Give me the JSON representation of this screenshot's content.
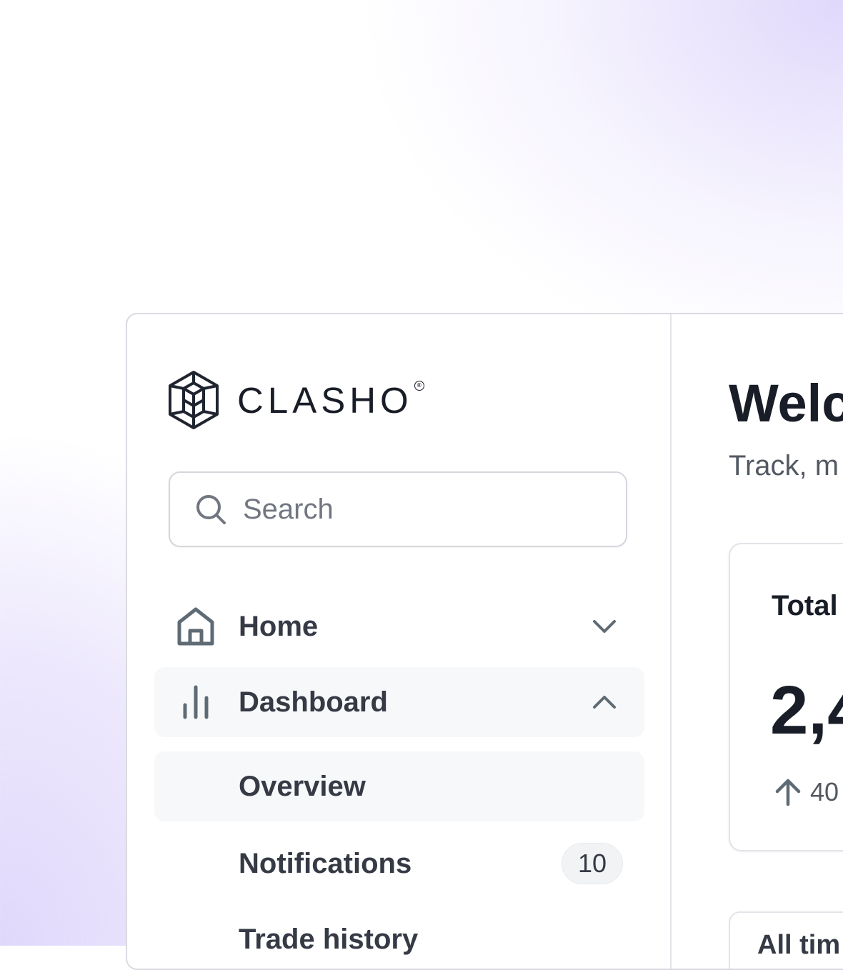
{
  "brand": {
    "name": "CLASHO",
    "registered_mark": "®",
    "logo_icon": "cube-lattice-logo"
  },
  "search": {
    "placeholder": "Search",
    "icon": "search-icon"
  },
  "nav": {
    "items": [
      {
        "label": "Home",
        "icon": "home-icon",
        "chevron": "chevron-down-icon"
      },
      {
        "label": "Dashboard",
        "icon": "bar-chart-icon",
        "chevron": "chevron-up-icon"
      }
    ],
    "sub_items": [
      {
        "label": "Overview"
      },
      {
        "label": "Notifications",
        "badge": "10"
      },
      {
        "label": "Trade history"
      }
    ]
  },
  "main": {
    "title": "Welc",
    "subtitle": "Track, m",
    "stat_card": {
      "title": "Total",
      "value": "2,4",
      "trend": "40",
      "trend_icon": "arrow-up-icon"
    },
    "filter": {
      "label": "All tim"
    }
  },
  "colors": {
    "accent_background": "#e0d8fb",
    "text_primary": "#181d27",
    "text_secondary": "#353a45",
    "border": "#d5d7dd"
  }
}
